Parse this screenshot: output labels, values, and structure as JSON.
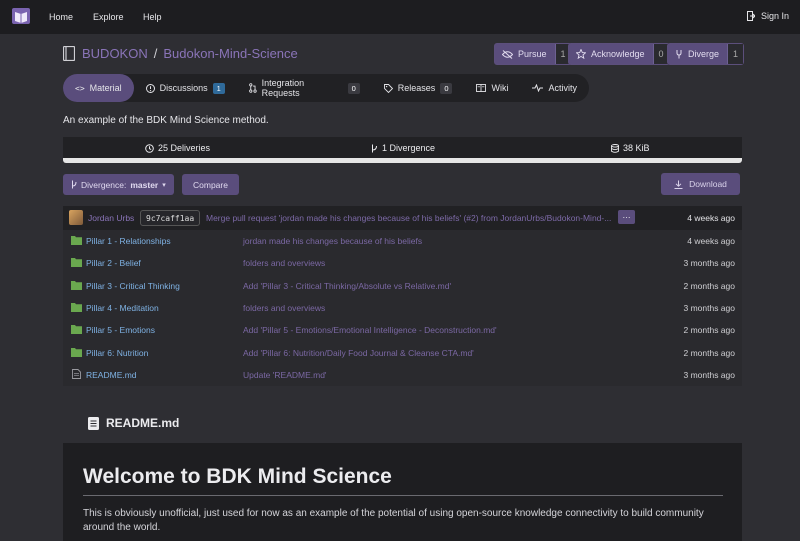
{
  "nav": {
    "links": [
      "Home",
      "Explore",
      "Help"
    ],
    "signin": "Sign In"
  },
  "repo": {
    "owner": "BUDOKON",
    "separator": "/",
    "name": "Budokon-Mind-Science",
    "description": "An example of the BDK Mind Science method."
  },
  "actions": [
    {
      "label": "Pursue",
      "count": "1",
      "icon": "eye-slash-icon"
    },
    {
      "label": "Acknowledge",
      "count": "0",
      "icon": "star-icon"
    },
    {
      "label": "Diverge",
      "count": "1",
      "icon": "fork-icon"
    }
  ],
  "tabs": [
    {
      "label": "Material",
      "icon": "code-icon",
      "badge": ""
    },
    {
      "label": "Discussions",
      "icon": "issue-icon",
      "badge": "1"
    },
    {
      "label": "Integration Requests",
      "icon": "pull-request-icon",
      "badge": "0"
    },
    {
      "label": "Releases",
      "icon": "tag-icon",
      "badge": "0"
    },
    {
      "label": "Wiki",
      "icon": "book-icon",
      "badge": ""
    },
    {
      "label": "Activity",
      "icon": "pulse-icon",
      "badge": ""
    }
  ],
  "stats": {
    "deliveries": "25 Deliveries",
    "divergence": "1 Divergence",
    "size": "38 KiB"
  },
  "toolbar": {
    "branch_prefix": "Divergence:",
    "branch": "master",
    "compare": "Compare",
    "download": "Download"
  },
  "commit": {
    "author": "Jordan Urbs",
    "sha": "9c7caff1aa",
    "message": "Merge pull request 'jordan made his changes because of his beliefs' (#2) from JordanUrbs/Budokon-Mind-...",
    "ellipsis": "···",
    "time": "4 weeks ago"
  },
  "files": [
    {
      "name": "Pillar 1 - Relationships",
      "type": "folder",
      "message": "jordan made his changes because of his beliefs",
      "time": "4 weeks ago"
    },
    {
      "name": "Pillar 2 - Belief",
      "type": "folder",
      "message": "folders and overviews",
      "time": "3 months ago"
    },
    {
      "name": "Pillar 3 - Critical Thinking",
      "type": "folder",
      "message": "Add 'Pillar 3 - Critical Thinking/Absolute vs Relative.md'",
      "time": "2 months ago"
    },
    {
      "name": "Pillar 4 - Meditation",
      "type": "folder",
      "message": "folders and overviews",
      "time": "3 months ago"
    },
    {
      "name": "Pillar 5 - Emotions",
      "type": "folder",
      "message": "Add 'Pillar 5 - Emotions/Emotional Intelligence - Deconstruction.md'",
      "time": "2 months ago"
    },
    {
      "name": "Pillar 6: Nutrition",
      "type": "folder",
      "message": "Add 'Pillar 6: Nutrition/Daily Food Journal & Cleanse CTA.md'",
      "time": "2 months ago"
    },
    {
      "name": "README.md",
      "type": "file",
      "message": "Update 'README.md'",
      "time": "3 months ago"
    }
  ],
  "readme": {
    "filename": "README.md",
    "title": "Welcome to BDK Mind Science",
    "text": "This is obviously unofficial, just used for now as an example of the potential of using open-source knowledge connectivity to build community around the world."
  },
  "colors": {
    "accent": "#5a4d7c",
    "link": "#8a74b8",
    "folder": "#6aa84f",
    "filename": "#7fb2e4"
  }
}
